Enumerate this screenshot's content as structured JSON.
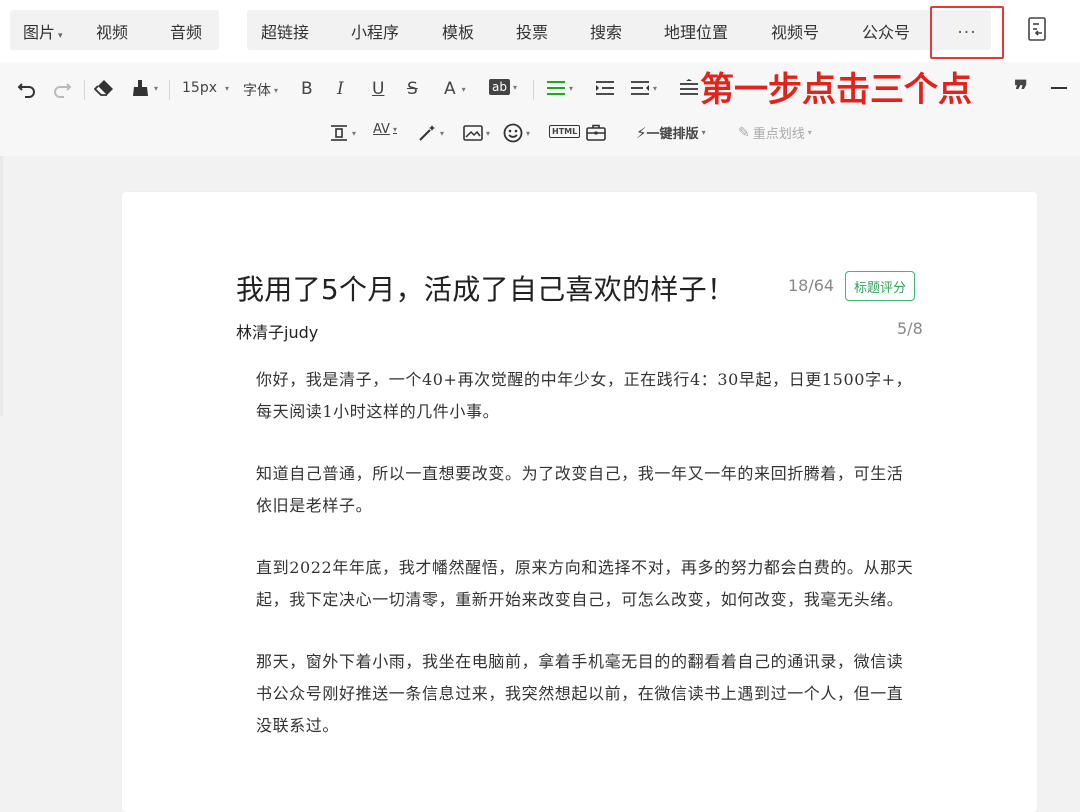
{
  "tabs_left": [
    {
      "label": "图片",
      "has_caret": true
    },
    {
      "label": "视频",
      "has_caret": false
    },
    {
      "label": "音频",
      "has_caret": false
    }
  ],
  "tabs_main": [
    {
      "label": "超链接"
    },
    {
      "label": "小程序"
    },
    {
      "label": "模板"
    },
    {
      "label": "投票"
    },
    {
      "label": "搜索"
    },
    {
      "label": "地理位置"
    },
    {
      "label": "视频号"
    },
    {
      "label": "公众号"
    }
  ],
  "more_button": {
    "label": "···",
    "icon": "more-dots-icon"
  },
  "side_panel_icon": "panel-exit-icon",
  "toolbar": {
    "font_size": "15px",
    "font_family": "字体",
    "bold": "B",
    "italic": "I",
    "underline": "U",
    "strike": "S",
    "font_color": "A",
    "highlight": "ab",
    "quote": "❞",
    "one_click_format": "一键排版",
    "key_underline": "重点划线",
    "html": "HTML",
    "icons": [
      "undo-icon",
      "redo-icon",
      "format-painter-icon",
      "clear-format-icon",
      "align-icon",
      "indent-icon",
      "list-icon",
      "line-height-icon",
      "letter-spacing-icon",
      "magic-wand-icon",
      "image-icon",
      "emoji-icon",
      "html-icon",
      "toolbox-icon",
      "lightning-icon",
      "highlighter-icon"
    ]
  },
  "annotation": "第一步点击三个点",
  "article": {
    "title": "我用了5个月，活成了自己喜欢的样子！",
    "title_count": "18/64",
    "title_score_button": "标题评分",
    "author": "林清子judy",
    "author_count": "5/8",
    "paragraphs": [
      "你好，我是清子，一个40+再次觉醒的中年少女，正在践行4：30早起，日更1500字+，每天阅读1小时这样的几件小事。",
      "知道自己普通，所以一直想要改变。为了改变自己，我一年又一年的来回折腾着，可生活依旧是老样子。",
      "直到2022年年底，我才幡然醒悟，原来方向和选择不对，再多的努力都会白费的。从那天起，我下定决心一切清零，重新开始来改变自己，可怎么改变，如何改变，我毫无头绪。",
      "那天，窗外下着小雨，我坐在电脑前，拿着手机毫无目的的翻看着自己的通讯录，微信读书公众号刚好推送一条信息过来，我突然想起以前，在微信读书上遇到过一个人，但一直没联系过。"
    ]
  },
  "colors": {
    "annotation_red": "#e0241c",
    "accent_green": "#2fa35d",
    "list_green": "#1aad19"
  }
}
